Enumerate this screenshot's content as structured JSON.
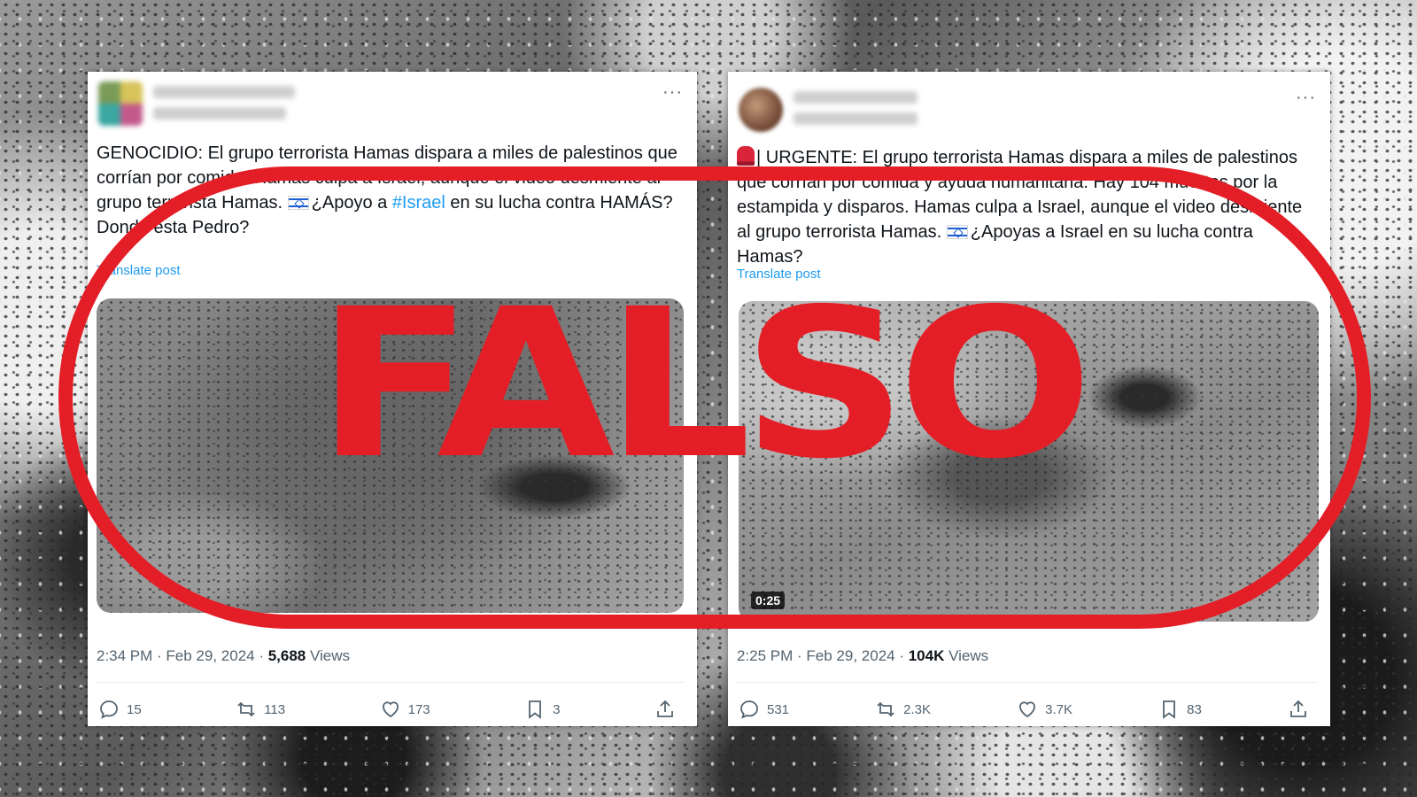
{
  "stamp": {
    "text": "FALSO",
    "color": "#e41e26"
  },
  "posts": [
    {
      "text_before_flag": "GENOCIDIO: El grupo terrorista Hamas dispara a miles de palestinos que corrían por comida. Hamas culpa a Israel, aunque el video desmiente al grupo terrorista Hamas. ",
      "text_after_flag": "¿Apoyo a ",
      "hashtag": "#Israel",
      "text_end": " en su lucha contra HAMÁS? Donde esta Pedro?",
      "translate": "Translate post",
      "time": "2:34 PM · Feb 29, 2024 · ",
      "views_count": "5,688",
      "views_label": " Views",
      "replies": "15",
      "reposts": "113",
      "likes": "173",
      "bookmarks": "3"
    },
    {
      "text_before_flag": "| URGENTE: El grupo terrorista Hamas dispara a miles de palestinos que corrían por comida y ayuda humanitaria. Hay 104 muertos por la estampida y disparos. Hamas culpa a Israel, aunque el video desmiente al grupo terrorista Hamas. ",
      "text_after_flag": "¿Apoyas a Israel en su lucha contra Hamas?",
      "translate": "Translate post",
      "video_time": "0:25",
      "time": "2:25 PM · Feb 29, 2024 · ",
      "views_count": "104K",
      "views_label": " Views",
      "replies": "531",
      "reposts": "2.3K",
      "likes": "3.7K",
      "bookmarks": "83"
    }
  ],
  "icons": [
    "more-icon",
    "israel-flag-icon",
    "siren-icon",
    "reply-icon",
    "repost-icon",
    "like-icon",
    "bookmark-icon",
    "share-icon"
  ]
}
